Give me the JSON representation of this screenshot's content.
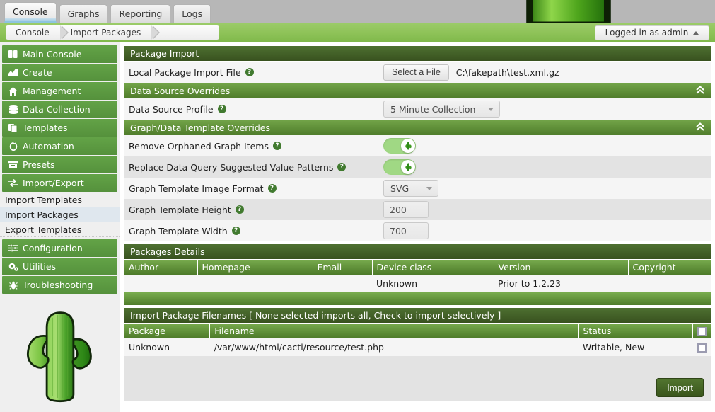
{
  "banner": {
    "logo_icon": "cacti-cactus-logo"
  },
  "tabs": [
    {
      "label": "Console",
      "active": true
    },
    {
      "label": "Graphs",
      "active": false
    },
    {
      "label": "Reporting",
      "active": false
    },
    {
      "label": "Logs",
      "active": false
    }
  ],
  "breadcrumb": {
    "items": [
      "Console",
      "Import Packages"
    ]
  },
  "user": {
    "label": "Logged in as admin",
    "caret_icon": "caret-up-icon"
  },
  "sidebar": {
    "items": [
      {
        "label": "Main Console",
        "icon": "book-icon",
        "glyph": "❙❙"
      },
      {
        "label": "Create",
        "icon": "chart-icon",
        "glyph": "◢"
      },
      {
        "label": "Management",
        "icon": "home-icon",
        "glyph": "⌂"
      },
      {
        "label": "Data Collection",
        "icon": "database-icon",
        "glyph": "≡"
      },
      {
        "label": "Templates",
        "icon": "copy-icon",
        "glyph": "❐"
      },
      {
        "label": "Automation",
        "icon": "refresh-icon",
        "glyph": "⟳"
      },
      {
        "label": "Presets",
        "icon": "archive-icon",
        "glyph": "▤"
      },
      {
        "label": "Import/Export",
        "icon": "exchange-icon",
        "glyph": "⇄"
      }
    ],
    "sub_items": [
      {
        "label": "Import Templates",
        "selected": false
      },
      {
        "label": "Import Packages",
        "selected": true
      },
      {
        "label": "Export Templates",
        "selected": false
      }
    ],
    "items_after": [
      {
        "label": "Configuration",
        "icon": "sliders-icon",
        "glyph": "☲"
      },
      {
        "label": "Utilities",
        "icon": "gears-icon",
        "glyph": "⚙"
      },
      {
        "label": "Troubleshooting",
        "icon": "bug-icon",
        "glyph": "☠"
      }
    ],
    "logo_icon": "cacti-cactus-logo"
  },
  "main": {
    "package_import": {
      "title": "Package Import",
      "file_row": {
        "label": "Local Package Import File",
        "help_icon": "question-circle-icon",
        "button_label": "Select a File",
        "file_name": "C:\\fakepath\\test.xml.gz"
      }
    },
    "data_source_overrides": {
      "title": "Data Source Overrides",
      "collapse_icon": "chevron-double-up-icon",
      "profile_row": {
        "label": "Data Source Profile",
        "help_icon": "question-circle-icon",
        "value": "5 Minute Collection",
        "caret_icon": "caret-down-icon"
      }
    },
    "graph_overrides": {
      "title": "Graph/Data Template Overrides",
      "collapse_icon": "chevron-double-up-icon",
      "rows": [
        {
          "label": "Remove Orphaned Graph Items",
          "type": "toggle",
          "on": true
        },
        {
          "label": "Replace Data Query Suggested Value Patterns",
          "type": "toggle",
          "on": true
        },
        {
          "label": "Graph Template Image Format",
          "type": "select",
          "value": "SVG"
        },
        {
          "label": "Graph Template Height",
          "type": "text",
          "value": "200"
        },
        {
          "label": "Graph Template Width",
          "type": "text",
          "value": "700"
        }
      ]
    },
    "packages_details": {
      "title": "Packages Details",
      "columns": [
        "Author",
        "Homepage",
        "Email",
        "Device class",
        "Version",
        "Copyright"
      ],
      "rows": [
        [
          "",
          "",
          "",
          "Unknown",
          "Prior to 1.2.23",
          ""
        ]
      ]
    },
    "import_filenames": {
      "title": "Import Package Filenames [ None selected imports all, Check to import selectively ]",
      "columns": [
        "Package",
        "Filename",
        "Status",
        ""
      ],
      "header_checkbox_icon": "checkbox-icon",
      "rows": [
        {
          "package": "Unknown",
          "filename": "/var/www/html/cacti/resource/test.php",
          "status": "Writable, New",
          "checked": false
        }
      ]
    },
    "import_button": {
      "label": "Import"
    }
  },
  "colors": {
    "brand_green": "#55913c",
    "header_dark": "#39521f",
    "header_mid": "#5a8c33",
    "crumb_bar": "#8dc257",
    "toggle_on": "#a0d884",
    "selected_sub": "#dfe7ee"
  }
}
